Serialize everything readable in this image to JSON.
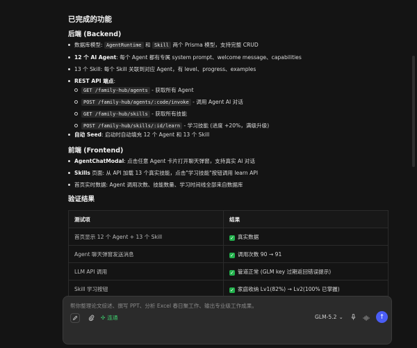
{
  "completed_title": "已完成的功能",
  "backend": {
    "heading": "后端 (Backend)",
    "items": {
      "db_prefix": "数据库模型: ",
      "db_code1": "AgentRuntime",
      "db_and": " 和 ",
      "db_code2": "Skill",
      "db_suffix": " 两个 Prisma 模型，支持完整 CRUD",
      "agents_bold": "12 个 AI Agent",
      "agents_rest": ": 每个 Agent 都有专属 system prompt、welcome message、capabilities",
      "skills_text": "13 个 Skill: 每个 Skill 关联到对应 Agent，有 level、progress、examples",
      "rest_bold": "REST API 端点",
      "rest_colon": ":",
      "seed_bold": "自动 Seed",
      "seed_rest": ": 启动时自动填充 12 个 Agent 和 13 个 Skill"
    },
    "endpoints": [
      {
        "code": "GET /family-hub/agents",
        "desc": " - 获取所有 Agent"
      },
      {
        "code": "POST /family-hub/agents/:code/invoke",
        "desc": " - 调用 Agent AI 对话"
      },
      {
        "code": "GET /family-hub/skills",
        "desc": " - 获取所有技能"
      },
      {
        "code": "POST /family-hub/skills/:id/learn",
        "desc": " - 学习技能 (进度 +20%，满级升级)"
      }
    ]
  },
  "frontend": {
    "heading": "前端 (Frontend)",
    "modal_bold": "AgentChatModal",
    "modal_rest": ": 点击任意 Agent 卡片打开聊天弹窗，支持真实 AI 对话",
    "skills_bold": "Skills",
    "skills_rest": " 页面: 从 API 加载 13 个真实技能，点击\"学习技能\"按钮调用 learn API",
    "home_text": "首页实时数据: Agent 调用次数、技能数量、学习时间线全部来自数据库"
  },
  "verify": {
    "heading": "验证结果",
    "headers": [
      "测试项",
      "结果"
    ],
    "rows": [
      [
        "首页显示 12 个 Agent + 13 个 Skill",
        "真实数据"
      ],
      [
        "Agent 聊天弹窗发送消息",
        "调用次数 90 → 91"
      ],
      [
        "LLM API 调用",
        "管道正常 (GLM key 过期返回错误提示)"
      ],
      [
        "Skill 学习按钮",
        "家庭收纳 Lv1(82%) → Lv2(100% 已掌握)"
      ]
    ]
  },
  "composer": {
    "placeholder": "帮你整理论文综述、撰写 PPT、分析 Excel 春日聚工作、输出专业级工作成果。",
    "network_label": "连通",
    "model": "GLM-5.2",
    "chevron": "⌄",
    "send_arrow": "↑"
  },
  "colors": {
    "accent": "#4a5df5",
    "success": "#22b14c",
    "network": "#3ecf6e"
  }
}
